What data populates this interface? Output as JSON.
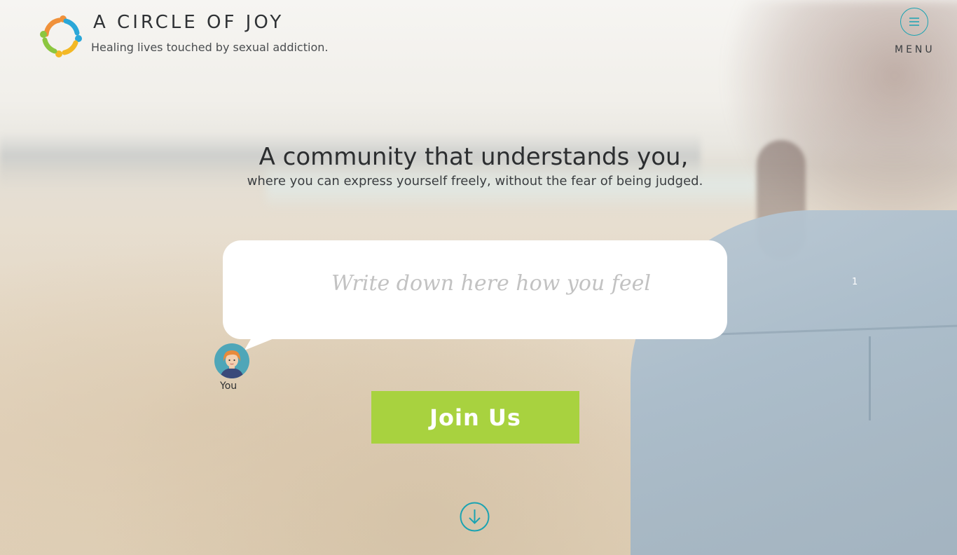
{
  "brand": {
    "title": "A CIRCLE OF JOY",
    "tagline": "Healing lives touched by sexual addiction.",
    "logo_icon": "circle-of-people-logo",
    "colors": [
      "#f0913a",
      "#2aa7d8",
      "#8cc63f",
      "#f3b825"
    ]
  },
  "header": {
    "menu_label": "MENU",
    "menu_icon": "hamburger-icon",
    "accent": "#1aa3b2"
  },
  "hero": {
    "title": "A community that understands you,",
    "subtitle": "where you can express yourself freely, without the fear of being judged."
  },
  "feel_box": {
    "placeholder": "Write down here how you feel",
    "value": ""
  },
  "user": {
    "label": "You",
    "avatar_icon": "user-avatar-icon"
  },
  "stray_text": "1",
  "cta": {
    "label": "Join Us",
    "color": "#a8d23f"
  },
  "scroll": {
    "icon": "arrow-down-circle-icon"
  }
}
